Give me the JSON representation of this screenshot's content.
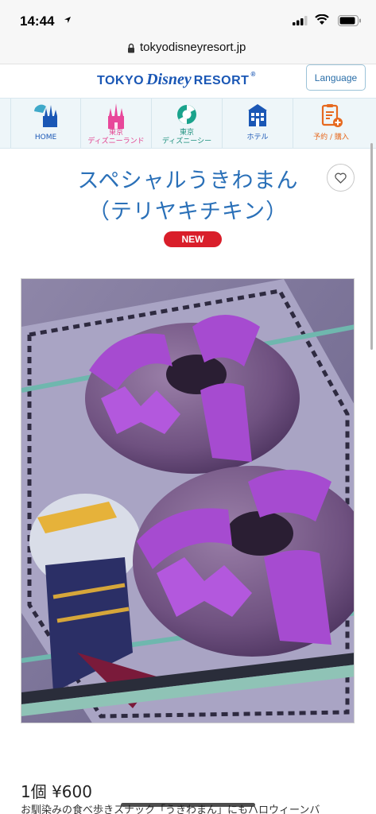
{
  "status_bar": {
    "time": "14:44"
  },
  "browser": {
    "url": "tokyodisneyresort.jp"
  },
  "header": {
    "brand_tokyo": "TOKYO",
    "brand_disney": "Disney",
    "brand_resort": "RESORT",
    "brand_reg": "®",
    "language_button": "Language"
  },
  "nav": {
    "items": [
      {
        "line1": "HOME",
        "line2": ""
      },
      {
        "line1": "東京",
        "line2": "ディズニーランド"
      },
      {
        "line1": "東京",
        "line2": "ディズニーシー"
      },
      {
        "line1": "ホテル",
        "line2": ""
      },
      {
        "line1": "予約 / 購入",
        "line2": ""
      }
    ]
  },
  "product": {
    "title_line1": "スペシャルうきわまん",
    "title_line2": "（テリヤキチキン）",
    "badge": "NEW",
    "price": "1個 ¥600",
    "description": "お馴染みの食べ歩きスナック「うきわまん」にもハロウィーンバ"
  },
  "colors": {
    "brand_blue": "#1a57b5",
    "title_blue": "#2a70b8",
    "badge_red": "#d91e2a",
    "nav_bg": "#eef6f9"
  }
}
